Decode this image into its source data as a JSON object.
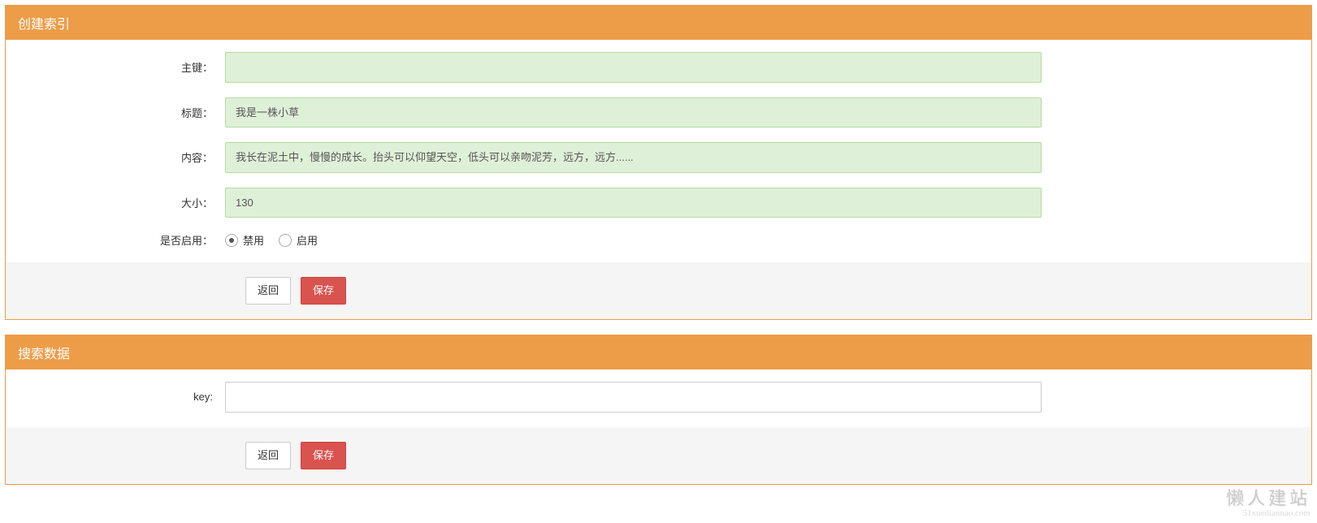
{
  "panel1": {
    "title": "创建索引",
    "fields": {
      "primary_key": {
        "label": "主键：",
        "value": ""
      },
      "title": {
        "label": "标题：",
        "value": "我是一株小草"
      },
      "content": {
        "label": "内容：",
        "value": "我长在泥土中，慢慢的成长。抬头可以仰望天空，低头可以亲吻泥芳，远方，远方......"
      },
      "size": {
        "label": "大小：",
        "value": "130"
      },
      "enabled": {
        "label": "是否启用：",
        "options": {
          "disable": "禁用",
          "enable": "启用"
        },
        "selected": "disable"
      }
    },
    "actions": {
      "back": "返回",
      "save": "保存"
    }
  },
  "panel2": {
    "title": "搜索数据",
    "fields": {
      "key": {
        "label": "key:",
        "value": ""
      }
    },
    "actions": {
      "back": "返回",
      "save": "保存"
    }
  },
  "watermark": {
    "main": "懒人建站",
    "sub": "51xuediannao.com"
  }
}
